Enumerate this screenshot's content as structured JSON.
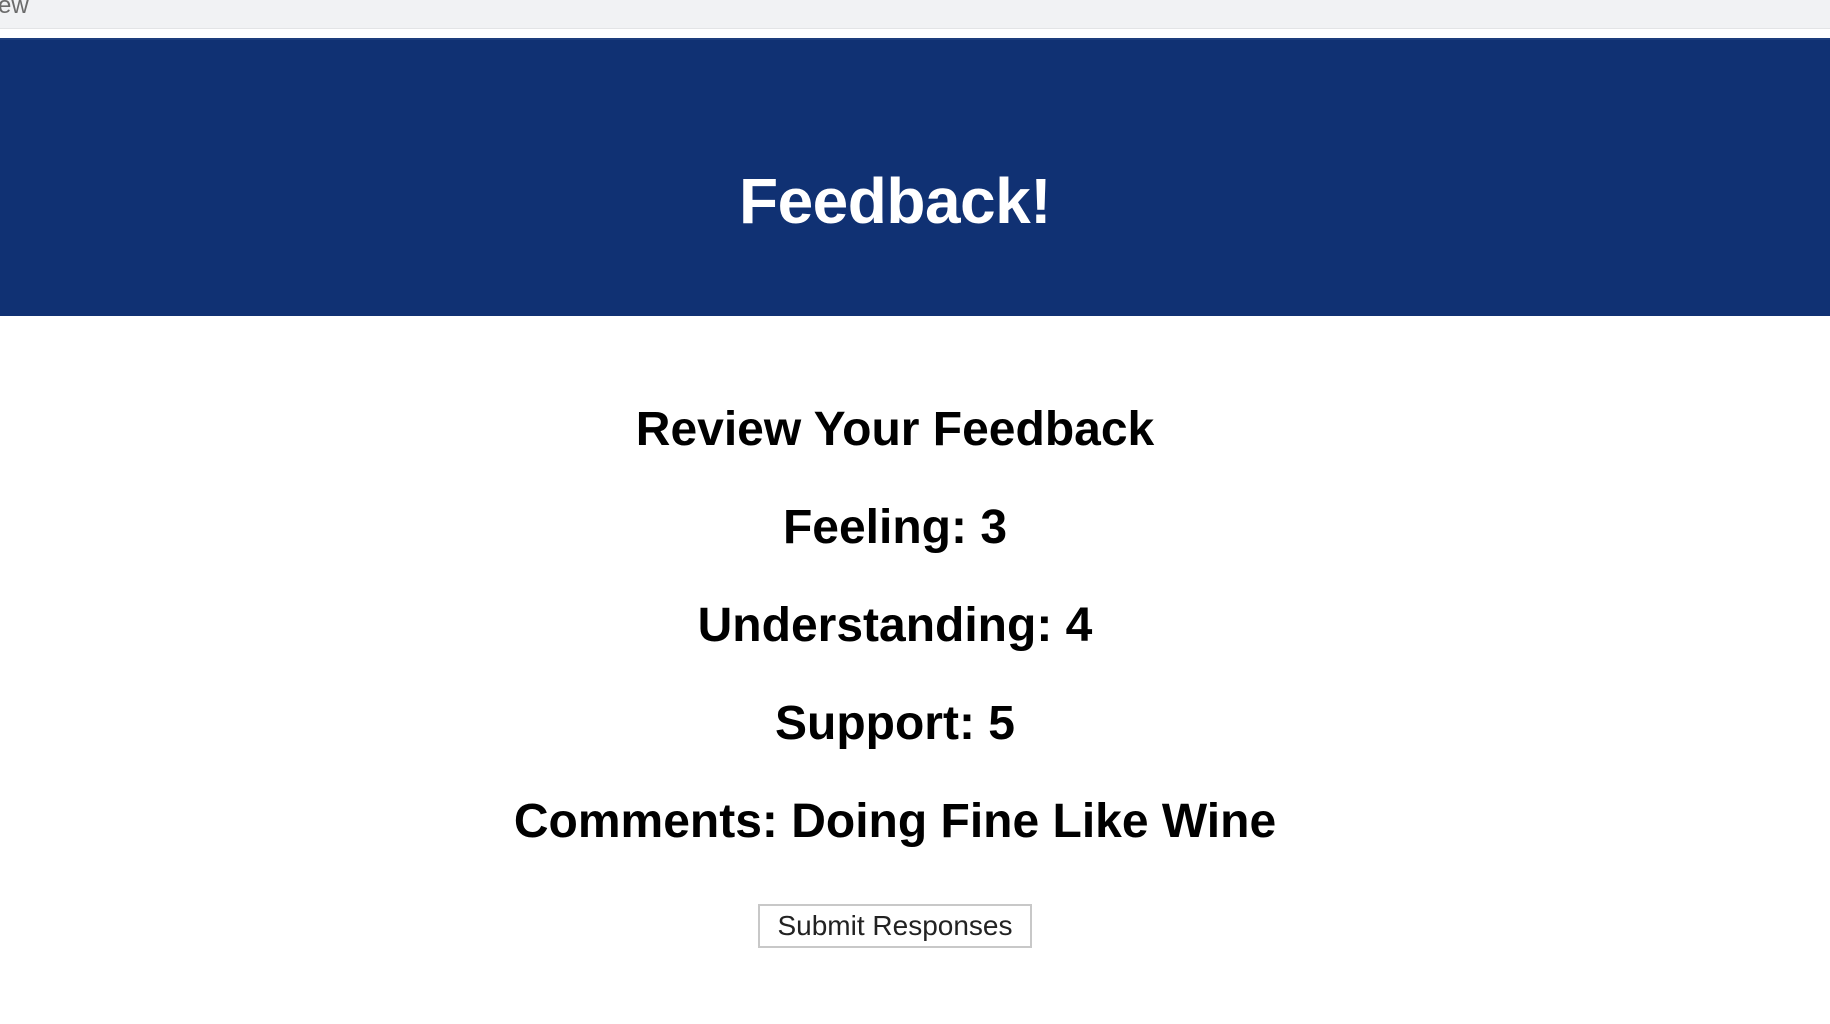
{
  "top_strip": {
    "partial_text": "ew"
  },
  "header": {
    "title": "Feedback!",
    "background_color": "#103173"
  },
  "review": {
    "heading": "Review Your Feedback",
    "items": [
      {
        "label": "Feeling:",
        "value": "3"
      },
      {
        "label": "Understanding:",
        "value": "4"
      },
      {
        "label": "Support:",
        "value": "5"
      },
      {
        "label": "Comments:",
        "value": "Doing Fine Like Wine"
      }
    ]
  },
  "actions": {
    "submit_label": "Submit Responses"
  }
}
